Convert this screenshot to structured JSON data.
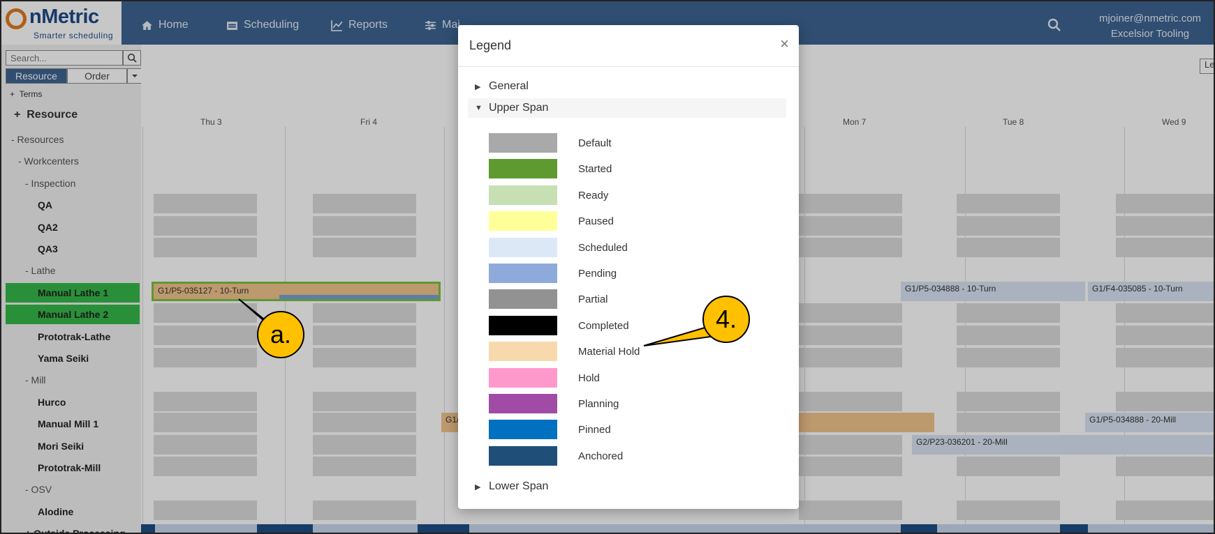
{
  "header": {
    "logo_text": "nMetric",
    "logo_tagline": "Smarter scheduling",
    "nav": [
      {
        "label": "Home",
        "icon": "home-icon"
      },
      {
        "label": "Scheduling",
        "icon": "calendar-icon"
      },
      {
        "label": "Reports",
        "icon": "chart-icon"
      },
      {
        "label": "Mai",
        "icon": "sliders-icon"
      }
    ],
    "user_email": "mjoiner@nmetric.com",
    "company": "Excelsior Tooling"
  },
  "sidebar": {
    "search_placeholder": "Search...",
    "toggle": {
      "resource": "Resource",
      "order": "Order"
    },
    "terms_label": "Terms",
    "resource_header": "Resource",
    "tree": [
      {
        "label": "- Resources",
        "level": 0,
        "bold": false,
        "highlight": false
      },
      {
        "label": "- Workcenters",
        "level": 1,
        "bold": false,
        "highlight": false
      },
      {
        "label": "- Inspection",
        "level": 2,
        "bold": false,
        "highlight": false
      },
      {
        "label": "QA",
        "level": 3,
        "bold": true,
        "highlight": false
      },
      {
        "label": "QA2",
        "level": 3,
        "bold": true,
        "highlight": false
      },
      {
        "label": "QA3",
        "level": 3,
        "bold": true,
        "highlight": false
      },
      {
        "label": "- Lathe",
        "level": 2,
        "bold": false,
        "highlight": false
      },
      {
        "label": "Manual Lathe 1",
        "level": 3,
        "bold": true,
        "highlight": true
      },
      {
        "label": "Manual Lathe 2",
        "level": 3,
        "bold": true,
        "highlight": true
      },
      {
        "label": "Prototrak-Lathe",
        "level": 3,
        "bold": true,
        "highlight": false
      },
      {
        "label": "Yama Seiki",
        "level": 3,
        "bold": true,
        "highlight": false
      },
      {
        "label": "- Mill",
        "level": 2,
        "bold": false,
        "highlight": false
      },
      {
        "label": "Hurco",
        "level": 3,
        "bold": true,
        "highlight": false
      },
      {
        "label": "Manual Mill 1",
        "level": 3,
        "bold": true,
        "highlight": false
      },
      {
        "label": "Mori Seiki",
        "level": 3,
        "bold": true,
        "highlight": false
      },
      {
        "label": "Prototrak-Mill",
        "level": 3,
        "bold": true,
        "highlight": false
      },
      {
        "label": "- OSV",
        "level": 2,
        "bold": false,
        "highlight": false
      },
      {
        "label": "Alodine",
        "level": 3,
        "bold": true,
        "highlight": false
      },
      {
        "label": "+ Outside Processing",
        "level": 2,
        "bold": true,
        "highlight": false
      }
    ]
  },
  "gantt": {
    "dates": [
      "Thu 3",
      "Fri 4",
      "Mon 7",
      "Tue 8",
      "Wed 9"
    ],
    "legend_button": "Le",
    "bars": [
      {
        "label": "G1/P5-035127 - 10-Turn"
      },
      {
        "label": "G1/P5-034888 - 10-Turn"
      },
      {
        "label": "G1/F4-035085 - 10-Turn"
      },
      {
        "label": "G1/"
      },
      {
        "label": "G1/P5-034888 - 20-Mill"
      },
      {
        "label": "G2/P23-036201 - 20-Mill"
      }
    ]
  },
  "modal": {
    "title": "Legend",
    "close": "×",
    "sections": {
      "general": "General",
      "upper": "Upper Span",
      "lower": "Lower Span"
    },
    "legend": [
      {
        "label": "Default",
        "color": "#a9a9a9"
      },
      {
        "label": "Started",
        "color": "#5f9a30"
      },
      {
        "label": "Ready",
        "color": "#c6e0b4"
      },
      {
        "label": "Paused",
        "color": "#ffff99"
      },
      {
        "label": "Scheduled",
        "color": "#dde8f7"
      },
      {
        "label": "Pending",
        "color": "#8eaadb"
      },
      {
        "label": "Partial",
        "color": "#929292"
      },
      {
        "label": "Completed",
        "color": "#000000"
      },
      {
        "label": "Material Hold",
        "color": "#f8d9ae"
      },
      {
        "label": "Hold",
        "color": "#ff99cc"
      },
      {
        "label": "Planning",
        "color": "#a04ca6"
      },
      {
        "label": "Pinned",
        "color": "#0070c0"
      },
      {
        "label": "Anchored",
        "color": "#1f4e79"
      }
    ]
  },
  "callouts": {
    "a": "a.",
    "four": "4."
  }
}
